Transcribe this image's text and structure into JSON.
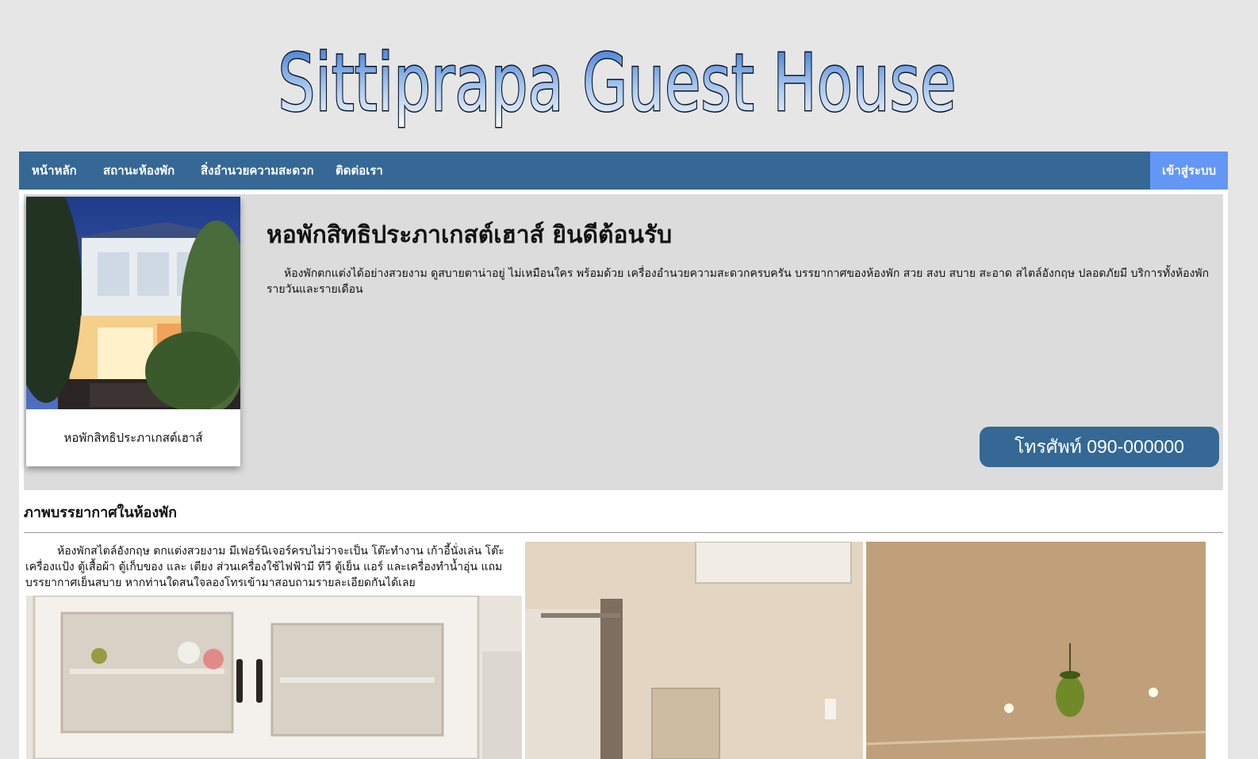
{
  "site": {
    "title": "Sittiprapa Guest House"
  },
  "nav": {
    "items": [
      "หน้าหลัก",
      "สถานะห้องพัก",
      "สิ่งอำนวยความสะดวก",
      "ติดต่อเรา"
    ],
    "login": "เข้าสู่ระบบ"
  },
  "hero": {
    "caption": "หอพักสิทธิประภาเกสต์เฮาส์",
    "title": "หอพักสิทธิประภาเกสต์เฮาส์ ยินดีต้อนรับ",
    "description": "ห้องพักตกแต่งได้อย่างสวยงาม ดูสบายตาน่าอยู่ ไม่เหมือนใคร พร้อมด้วย เครื่องอำนวยความสะดวกครบครัน บรรยากาศของห้องพัก สวย สงบ สบาย สะอาด สไตล์อังกฤษ ปลอดภัยมี บริการทั้งห้องพักรายวันและรายเดือน",
    "phone": "โทรศัพท์ 090-000000"
  },
  "rooms": {
    "section_title": "ภาพบรรยากาศในห้องพัก",
    "description": "ห้องพักสไตล์อังกฤษ ตกแต่งสวยงาม มีเฟอร์นิเจอร์ครบไม่ว่าจะเป็น โต๊ะทำงาน เก้าอี้นั่งเล่น โต๊ะเครื่องแป้ง ตู้เสื้อผ้า ตู้เก็บของ และ เตียง ส่วนเครื่องใช้ไฟฟ้ามี ทีวี ตู้เย็น แอร์ และเครื่องทำน้ำอุ่น แถมบรรยากาศเย็นสบาย หากท่านใดสนใจลองโทรเข้ามาสอบถามรายละเอียดกันได้เลย"
  },
  "colors": {
    "nav": "#356895",
    "login": "#6496f5",
    "hero_bg": "#dcdcdc",
    "page_bg": "#e6e6e6"
  }
}
